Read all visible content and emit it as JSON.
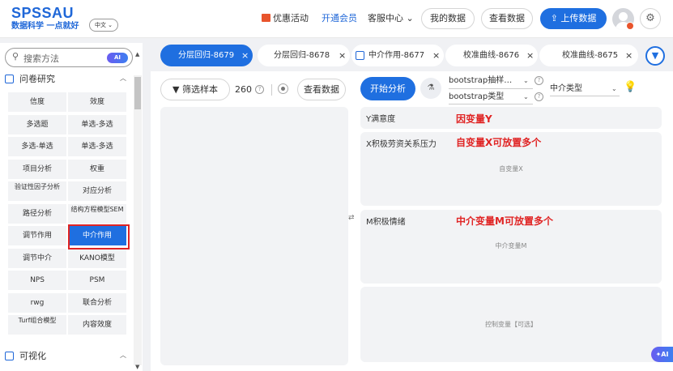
{
  "header": {
    "logo_main": "SPSSAU",
    "logo_sub": "数据科学 一点就好",
    "language": "中文 ⌄",
    "promo": "优惠活动",
    "vip": "开通会员",
    "service": "客服中心 ⌄",
    "my_data": "我的数据",
    "view_data": "查看数据",
    "upload": "⇪ 上传数据",
    "accent": "#1f6fe0"
  },
  "sidebar": {
    "search_placeholder": "搜索方法",
    "ai_badge": "AI",
    "section_survey": "问卷研究",
    "section_visual": "可视化",
    "methods": [
      "信度",
      "效度",
      "多选题",
      "单选-多选",
      "多选-单选",
      "单选-多选",
      "项目分析",
      "权重",
      "验证性因子分析",
      "对应分析",
      "路径分析",
      "结构方程模型SEM",
      "调节作用",
      "中介作用",
      "调节中介",
      "KANO模型",
      "NPS",
      "PSM",
      "rwg",
      "联合分析",
      "Turf组合模型",
      "内容效度"
    ],
    "active_method": "中介作用"
  },
  "tabs": [
    {
      "label": "分层回归-8679",
      "close": "×",
      "active": true
    },
    {
      "label": "分层回归-8678",
      "close": "×",
      "active": false
    },
    {
      "label": "中介作用-8677",
      "close": "×",
      "active": false
    },
    {
      "label": "校准曲线-8676",
      "close": "×",
      "active": false
    },
    {
      "label": "校准曲线-8675",
      "close": "×",
      "active": false
    }
  ],
  "toolbar": {
    "filter": "筛选样本",
    "count": "260",
    "view_data": "查看数据",
    "start": "开始分析",
    "bootstrap_sampling": "bootstrap抽样…",
    "bootstrap_type": "bootstrap类型",
    "mediation_type": "中介类型"
  },
  "drop_zones": {
    "y_label": "Y满意度",
    "y_note": "因变量Y",
    "x_label": "X积极劳资关系压力",
    "x_note": "自变量X可放置多个",
    "x_hint": "自变量X",
    "m_label": "M积极情绪",
    "m_note": "中介变量M可放置多个",
    "m_hint": "中介变量M",
    "control_hint": "控制变量【可选】"
  },
  "float_ai": "AI"
}
